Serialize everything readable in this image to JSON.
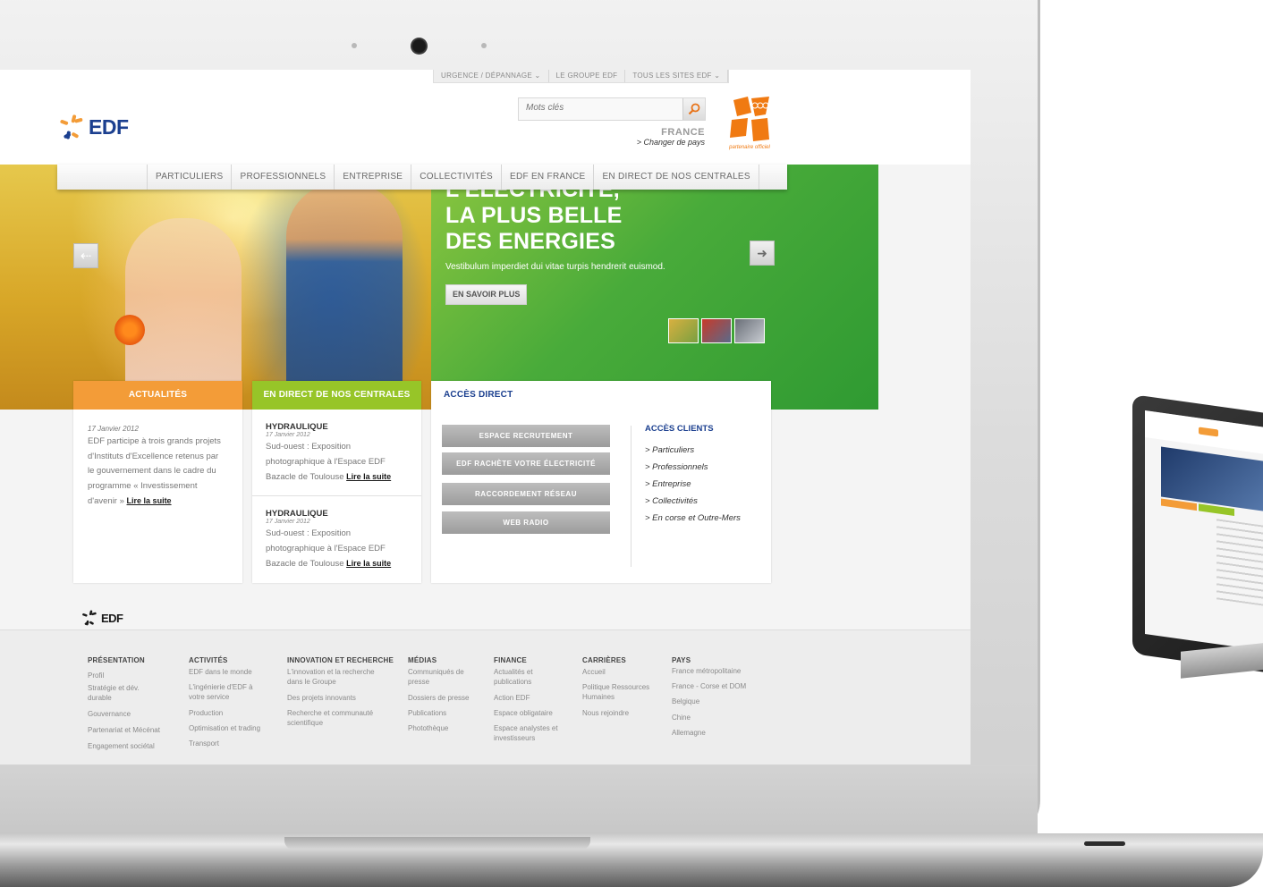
{
  "util_nav": [
    "URGENCE / DÉPANNAGE ⌄",
    "LE GROUPE EDF",
    "TOUS LES SITES EDF ⌄"
  ],
  "brand": {
    "logo": "EDF",
    "footer_logo": "EDF",
    "color_blue": "#1b3f8f",
    "color_orange": "#f39c38",
    "color_green": "#97c528"
  },
  "search": {
    "placeholder": "Mots clés"
  },
  "country": {
    "name": "FRANCE",
    "change_link": "> Changer de pays"
  },
  "partner": "partenaire officiel",
  "main_nav": [
    "PARTICULIERS",
    "PROFESSIONNELS",
    "ENTREPRISE",
    "COLLECTIVITÉS",
    "EDF EN FRANCE",
    "EN DIRECT DE NOS CENTRALES"
  ],
  "hero": {
    "title_lines": [
      "L'ÉLECTRICITÉ,",
      "LA PLUS BELLE",
      "DES ENERGIES"
    ],
    "text": "Vestibulum imperdiet dui vitae turpis hendrerit euismod.",
    "button": "EN SAVOIR PLUS"
  },
  "news": {
    "header": "ACTUALITÉS",
    "date": "17 Janvier 2012",
    "lines": [
      "EDF participe à trois grands projets",
      "d'Instituts d'Excellence retenus par",
      "le gouvernement dans le cadre du",
      "programme « Investissement",
      "d'avenir » "
    ],
    "read_more": "Lire la suite"
  },
  "live": {
    "header": "EN DIRECT DE NOS CENTRALES",
    "items": [
      {
        "title": "HYDRAULIQUE",
        "date": "17 Janvier 2012",
        "lines": [
          "Sud-ouest : Exposition",
          "photographique à l'Espace EDF",
          "Bazacle de Toulouse "
        ],
        "read_more": "Lire la suite"
      },
      {
        "title": "HYDRAULIQUE",
        "date": "17 Janvier 2012",
        "lines": [
          "Sud-ouest : Exposition",
          "photographique à l'Espace EDF",
          "Bazacle de Toulouse "
        ],
        "read_more": "Lire la suite"
      }
    ]
  },
  "access": {
    "header": "ACCÈS DIRECT",
    "buttons": [
      "ESPACE RECRUTEMENT",
      "EDF RACHÈTE VOTRE ÉLECTRICITÉ",
      "RACCORDEMENT RÉSEAU",
      "WEB RADIO"
    ],
    "clients_title": "ACCÈS CLIENTS",
    "clients": [
      "> Particuliers",
      "> Professionnels",
      "> Entreprise",
      "> Collectivités",
      "> En corse et Outre-Mers"
    ]
  },
  "footer": {
    "columns": [
      {
        "title": "PRÉSENTATION",
        "links": [
          "Profil",
          "Stratégie et dév.\ndurable",
          "Gouvernance",
          "Partenariat et Mécénat",
          "Engagement sociétal"
        ]
      },
      {
        "title": "ACTIVITÉS",
        "links": [
          "EDF dans le monde",
          "L'ingénierie d'EDF à\nvotre service",
          "Production",
          "Optimisation et trading",
          "Transport"
        ]
      },
      {
        "title": "INNOVATION ET RECHERCHE",
        "links": [
          "L'innovation et la recherche\ndans le Groupe",
          "Des projets innovants",
          "Recherche et communauté\nscientifique"
        ]
      },
      {
        "title": "MÉDIAS",
        "links": [
          "Communiqués de\npresse",
          "Dossiers de presse",
          "Publications",
          "Photothèque"
        ]
      },
      {
        "title": "FINANCE",
        "links": [
          "Actualités et\npublications",
          "Action EDF",
          "Espace obligataire",
          "Espace analystes et\ninvestisseurs"
        ]
      },
      {
        "title": "CARRIÈRES",
        "links": [
          "Accueil",
          "Politique Ressources\nHumaines",
          "Nous rejoindre"
        ]
      },
      {
        "title": "PAYS",
        "links": [
          "France métropolitaine",
          "France - Corse et DOM",
          "Belgique",
          "Chine",
          "Allemagne"
        ]
      }
    ]
  }
}
